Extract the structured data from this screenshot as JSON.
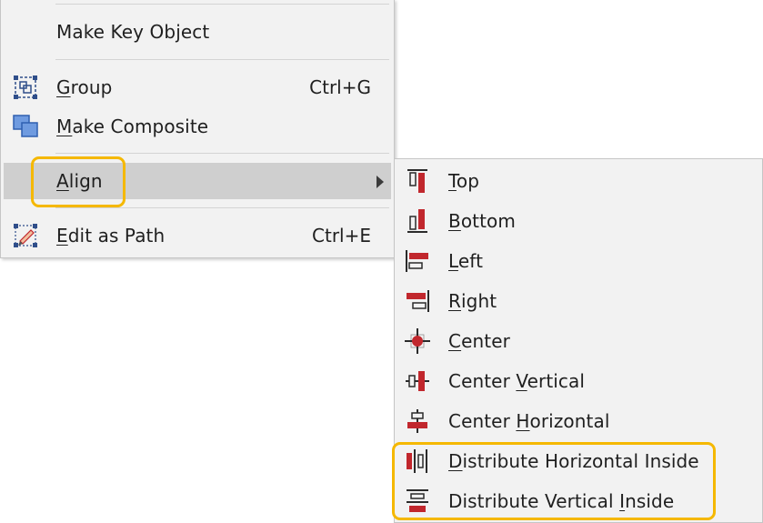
{
  "main_menu": {
    "make_key_object": "Make Key Object",
    "group": {
      "pre": "",
      "u": "G",
      "post": "roup",
      "shortcut": "Ctrl+G"
    },
    "make_composite": {
      "pre": "",
      "u": "M",
      "post": "ake Composite"
    },
    "align": {
      "pre": "",
      "u": "A",
      "post": "lign"
    },
    "edit_as_path": {
      "pre": "",
      "u": "E",
      "post": "dit as Path",
      "shortcut": "Ctrl+E"
    }
  },
  "align_submenu": {
    "top": {
      "pre": "",
      "u": "T",
      "post": "op"
    },
    "bottom": {
      "pre": "",
      "u": "B",
      "post": "ottom"
    },
    "left": {
      "pre": "",
      "u": "L",
      "post": "eft"
    },
    "right": {
      "pre": "",
      "u": "R",
      "post": "ight"
    },
    "center": {
      "pre": "",
      "u": "C",
      "post": "enter"
    },
    "center_vertical": {
      "pre": "Center ",
      "u": "V",
      "post": "ertical"
    },
    "center_horizontal": {
      "pre": "Center ",
      "u": "H",
      "post": "orizontal"
    },
    "distribute_horizontal_inside": {
      "pre": "",
      "u": "D",
      "post": "istribute Horizontal Inside"
    },
    "distribute_vertical_inside": {
      "pre": "Distribute Vertical ",
      "u": "I",
      "post": "nside"
    }
  },
  "colors": {
    "highlight": "#cfcfcf",
    "callout": "#f5b800",
    "icon_red": "#c1272d",
    "icon_dark": "#2b2b2b",
    "icon_blue": "#2f6fd1"
  }
}
